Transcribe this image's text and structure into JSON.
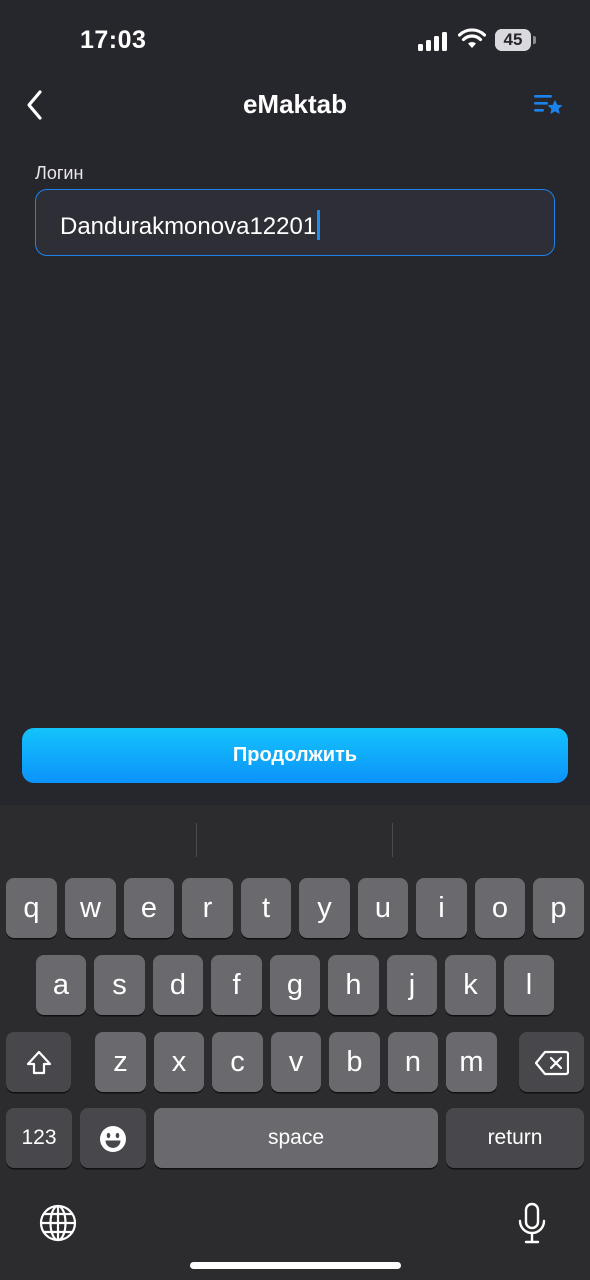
{
  "status_bar": {
    "time": "17:03",
    "battery": "45",
    "battery_level": 0.45
  },
  "nav": {
    "title": "eMaktab",
    "back_icon": "chevron-left-icon",
    "favorites_icon": "list-star-icon"
  },
  "form": {
    "label": "Логин",
    "value": "Dandurakmonova12201"
  },
  "continue_label": "Продолжить",
  "keyboard": {
    "row1": [
      "q",
      "w",
      "e",
      "r",
      "t",
      "y",
      "u",
      "i",
      "o",
      "p"
    ],
    "row2": [
      "a",
      "s",
      "d",
      "f",
      "g",
      "h",
      "j",
      "k",
      "l"
    ],
    "row3": [
      "z",
      "x",
      "c",
      "v",
      "b",
      "n",
      "m"
    ],
    "numbers_label": "123",
    "space_label": "space",
    "return_label": "return",
    "icons": {
      "shift": "shift-icon",
      "delete": "backspace-icon",
      "emoji": "emoji-icon",
      "globe": "globe-icon",
      "mic": "microphone-icon"
    }
  },
  "colors": {
    "background": "#26262d",
    "accent": "#1b83ea",
    "button_top": "#14c3fb",
    "button_bottom": "#0c93fb",
    "keyboard": "#2c2c2e"
  }
}
